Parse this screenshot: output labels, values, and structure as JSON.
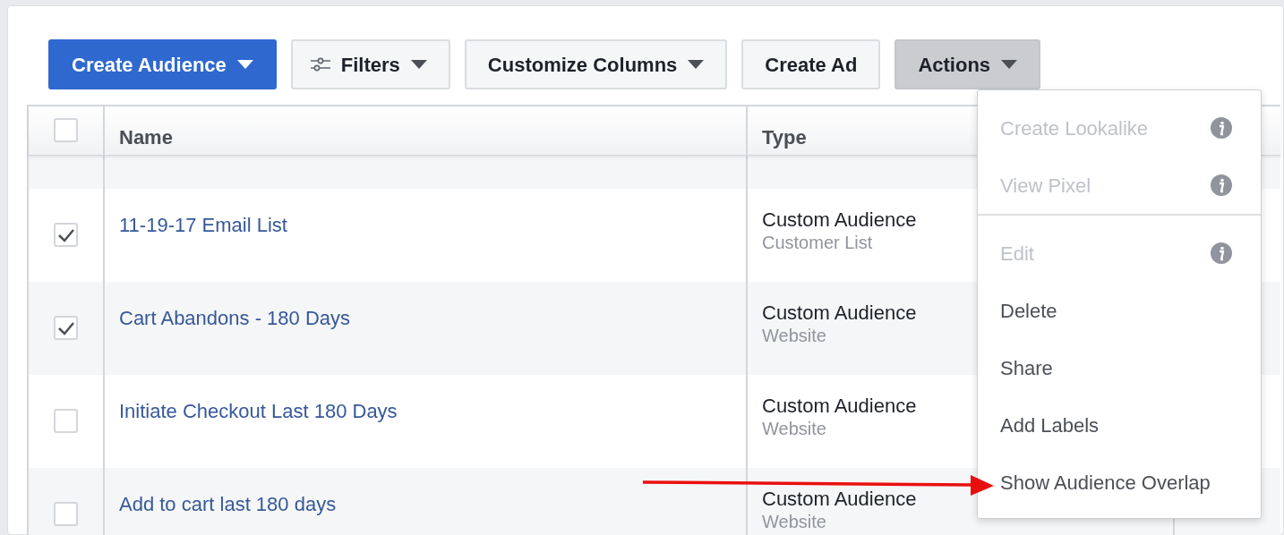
{
  "toolbar": {
    "buttons": [
      {
        "label": "Create Audience",
        "kind": "primary",
        "caret": true,
        "pressed": false
      },
      {
        "label": "Filters",
        "kind": "filter",
        "caret": true,
        "pressed": false
      },
      {
        "label": "Customize Columns",
        "kind": "default",
        "caret": true,
        "pressed": false
      },
      {
        "label": "Create Ad",
        "kind": "default",
        "caret": false,
        "pressed": false
      },
      {
        "label": "Actions",
        "kind": "default",
        "caret": true,
        "pressed": true
      }
    ]
  },
  "table": {
    "header_checkbox": {
      "checked": false
    },
    "columns": [
      {
        "label": "Name"
      },
      {
        "label": "Type"
      }
    ],
    "rows": [
      {
        "kind": "partial"
      },
      {
        "kind": "full",
        "checked": true,
        "name": "11-19-17 Email List",
        "type": "Custom Audience",
        "subtype": "Customer List"
      },
      {
        "kind": "full",
        "checked": true,
        "name": "Cart Abandons - 180 Days",
        "type": "Custom Audience",
        "subtype": "Website"
      },
      {
        "kind": "full",
        "checked": false,
        "name": "Initiate Checkout Last 180 Days",
        "type": "Custom Audience",
        "subtype": "Website"
      },
      {
        "kind": "full",
        "checked": false,
        "name": "Add to cart last 180 days",
        "type": "Custom Audience",
        "subtype": "Website"
      }
    ]
  },
  "actions_menu": {
    "sections": [
      {
        "items": [
          {
            "label": "Create Lookalike",
            "disabled": true,
            "info": true
          },
          {
            "label": "View Pixel",
            "disabled": true,
            "info": true
          }
        ]
      },
      {
        "items": [
          {
            "label": "Edit",
            "disabled": true,
            "info": true
          },
          {
            "label": "Delete",
            "disabled": false,
            "info": false
          },
          {
            "label": "Share",
            "disabled": false,
            "info": false
          },
          {
            "label": "Add Labels",
            "disabled": false,
            "info": false
          },
          {
            "label": "Show Audience Overlap",
            "disabled": false,
            "info": false
          }
        ]
      }
    ]
  },
  "annotation": {
    "kind": "arrow"
  }
}
